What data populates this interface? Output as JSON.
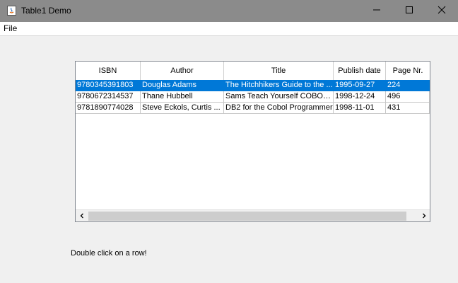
{
  "window": {
    "title": "Table1 Demo",
    "colors": {
      "titlebar": "#8b8b8b",
      "selection": "#0078d7"
    }
  },
  "menu": {
    "file_label": "File"
  },
  "table": {
    "columns": [
      "ISBN",
      "Author",
      "Title",
      "Publish date",
      "Page Nr."
    ],
    "rows": [
      [
        "9780345391803",
        "Douglas Adams",
        "The Hitchhikers Guide to the ...",
        "1995-09-27",
        "224"
      ],
      [
        "9780672314537",
        "Thane Hubbell",
        "Sams Teach Yourself COBOL ...",
        "1998-12-24",
        "496"
      ],
      [
        "9781890774028",
        "Steve Eckols, Curtis ...",
        "DB2 for the Cobol Programmer",
        "1998-11-01",
        "431"
      ]
    ],
    "selected_row": 0
  },
  "status": {
    "hint": "Double click on a row!"
  }
}
